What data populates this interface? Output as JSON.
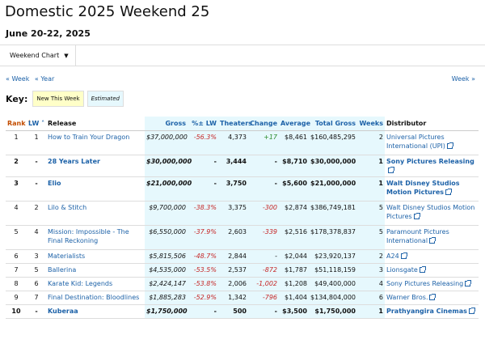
{
  "page": {
    "title": "Domestic 2025 Weekend 25",
    "dates": "June 20-22, 2025"
  },
  "nav": {
    "chart_tab": "Weekend Chart",
    "prev_week": "« Week",
    "prev_year": "« Year",
    "next_week": "Week »"
  },
  "key": {
    "label": "Key:",
    "new": "New This Week",
    "estimated": "Estimated"
  },
  "table": {
    "headers": {
      "rank": "Rank",
      "lw": "LW",
      "release": "Release",
      "gross": "Gross",
      "pct": "%± LW",
      "theaters": "Theaters",
      "change": "Change",
      "average": "Average",
      "total": "Total Gross",
      "weeks": "Weeks",
      "distributor": "Distributor"
    },
    "rows": [
      {
        "rank": "1",
        "lw": "1",
        "release": "How to Train Your Dragon",
        "gross": "$37,000,000",
        "pct": "-56.3%",
        "theaters": "4,373",
        "change": "+17",
        "average": "$8,461",
        "total": "$160,485,295",
        "weeks": "2",
        "distributor": "Universal Pictures International (UPI)"
      },
      {
        "rank": "2",
        "lw": "-",
        "release": "28 Years Later",
        "gross": "$30,000,000",
        "pct": "-",
        "theaters": "3,444",
        "change": "-",
        "average": "$8,710",
        "total": "$30,000,000",
        "weeks": "1",
        "distributor": "Sony Pictures Releasing"
      },
      {
        "rank": "3",
        "lw": "-",
        "release": "Elio",
        "gross": "$21,000,000",
        "pct": "-",
        "theaters": "3,750",
        "change": "-",
        "average": "$5,600",
        "total": "$21,000,000",
        "weeks": "1",
        "distributor": "Walt Disney Studios Motion Pictures"
      },
      {
        "rank": "4",
        "lw": "2",
        "release": "Lilo & Stitch",
        "gross": "$9,700,000",
        "pct": "-38.3%",
        "theaters": "3,375",
        "change": "-300",
        "average": "$2,874",
        "total": "$386,749,181",
        "weeks": "5",
        "distributor": "Walt Disney Studios Motion Pictures"
      },
      {
        "rank": "5",
        "lw": "4",
        "release": "Mission: Impossible - The Final Reckoning",
        "gross": "$6,550,000",
        "pct": "-37.9%",
        "theaters": "2,603",
        "change": "-339",
        "average": "$2,516",
        "total": "$178,378,837",
        "weeks": "5",
        "distributor": "Paramount Pictures International"
      },
      {
        "rank": "6",
        "lw": "3",
        "release": "Materialists",
        "gross": "$5,815,506",
        "pct": "-48.7%",
        "theaters": "2,844",
        "change": "-",
        "average": "$2,044",
        "total": "$23,920,137",
        "weeks": "2",
        "distributor": "A24"
      },
      {
        "rank": "7",
        "lw": "5",
        "release": "Ballerina",
        "gross": "$4,535,000",
        "pct": "-53.5%",
        "theaters": "2,537",
        "change": "-872",
        "average": "$1,787",
        "total": "$51,118,159",
        "weeks": "3",
        "distributor": "Lionsgate"
      },
      {
        "rank": "8",
        "lw": "6",
        "release": "Karate Kid: Legends",
        "gross": "$2,424,147",
        "pct": "-53.8%",
        "theaters": "2,006",
        "change": "-1,002",
        "average": "$1,208",
        "total": "$49,400,000",
        "weeks": "4",
        "distributor": "Sony Pictures Releasing"
      },
      {
        "rank": "9",
        "lw": "7",
        "release": "Final Destination: Bloodlines",
        "gross": "$1,885,283",
        "pct": "-52.9%",
        "theaters": "1,342",
        "change": "-796",
        "average": "$1,404",
        "total": "$134,804,000",
        "weeks": "6",
        "distributor": "Warner Bros."
      },
      {
        "rank": "10",
        "lw": "-",
        "release": "Kuberaa",
        "gross": "$1,750,000",
        "pct": "-",
        "theaters": "500",
        "change": "-",
        "average": "$3,500",
        "total": "$1,750,000",
        "weeks": "1",
        "distributor": "Prathyangira Cinemas"
      }
    ]
  },
  "colors": {
    "link": "#1d62a8",
    "negative": "#c62828",
    "positive": "#2a8a2a",
    "highlight_bg": "#e6f8fd",
    "new_bg": "#ffffc8",
    "sorted_header": "#c34d00"
  }
}
